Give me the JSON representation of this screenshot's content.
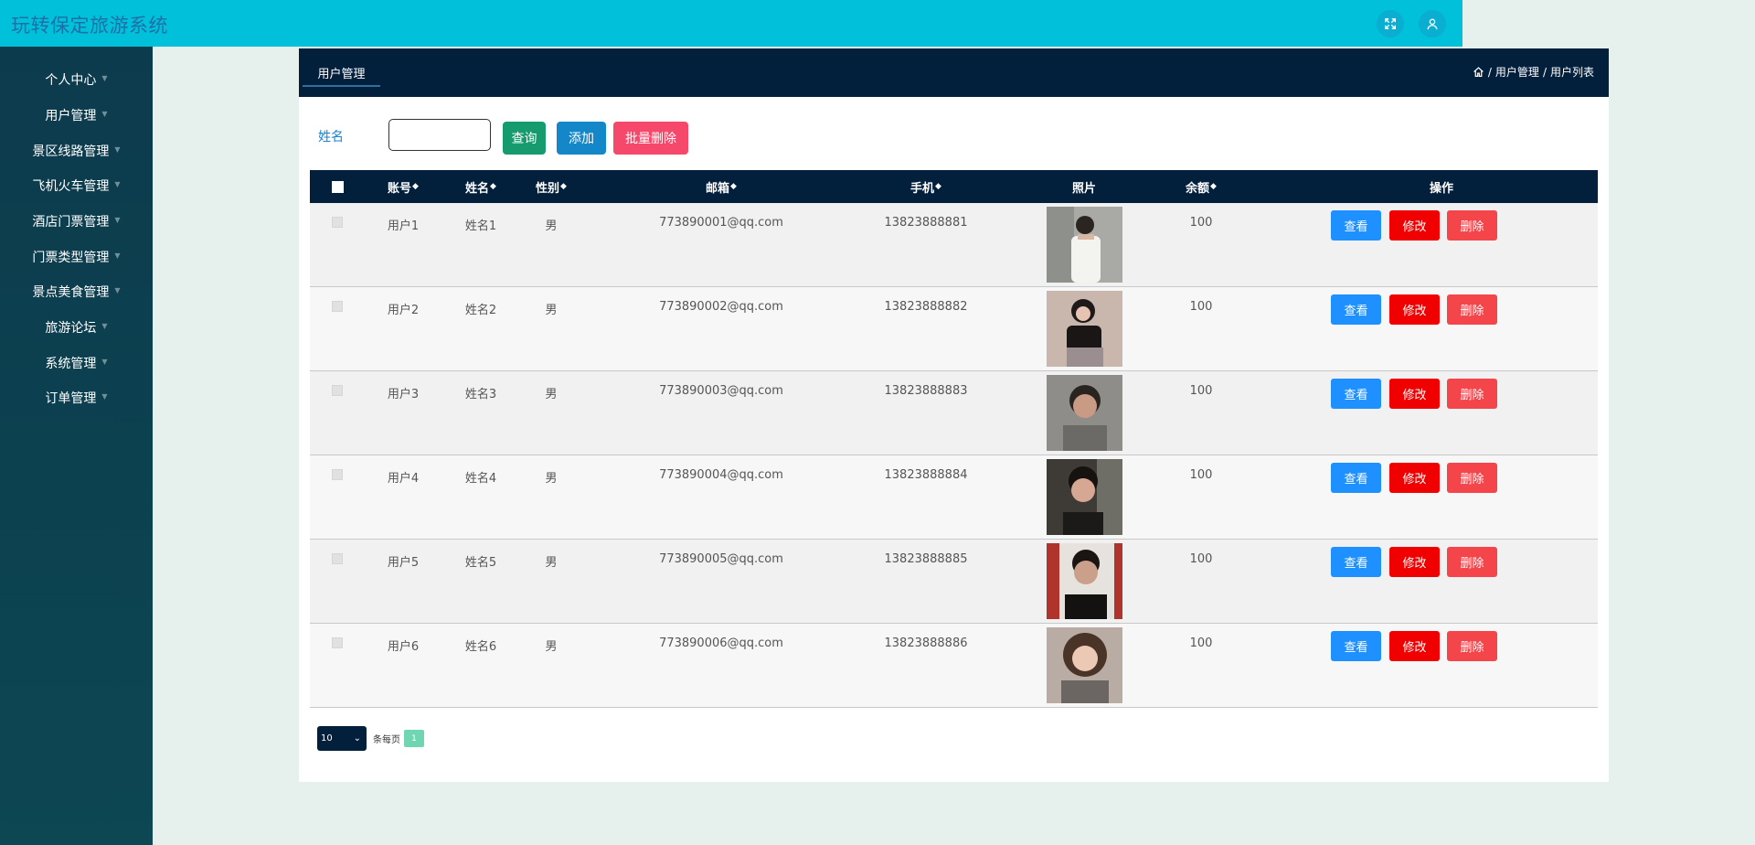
{
  "app": {
    "title": "玩转保定旅游系统"
  },
  "topbar": {
    "icons": [
      "fullscreen-icon",
      "user-icon"
    ]
  },
  "sidebar": {
    "items": [
      {
        "label": "个人中心"
      },
      {
        "label": "用户管理"
      },
      {
        "label": "景区线路管理"
      },
      {
        "label": "飞机火车管理"
      },
      {
        "label": "酒店门票管理"
      },
      {
        "label": "门票类型管理"
      },
      {
        "label": "景点美食管理"
      },
      {
        "label": "旅游论坛"
      },
      {
        "label": "系统管理"
      },
      {
        "label": "订单管理"
      }
    ]
  },
  "panel": {
    "tab": "用户管理",
    "breadcrumb": [
      "用户管理",
      "用户列表"
    ]
  },
  "search": {
    "label": "姓名",
    "value": "",
    "query_button": "查询",
    "add_button": "添加",
    "batch_delete_button": "批量删除"
  },
  "table": {
    "headers": {
      "account": "账号",
      "name": "姓名",
      "gender": "性别",
      "email": "邮箱",
      "phone": "手机",
      "photo": "照片",
      "balance": "余额",
      "actions": "操作"
    },
    "rows": [
      {
        "account": "用户1",
        "name": "姓名1",
        "gender": "男",
        "email": "773890001@qq.com",
        "phone": "13823888881",
        "balance": "100"
      },
      {
        "account": "用户2",
        "name": "姓名2",
        "gender": "男",
        "email": "773890002@qq.com",
        "phone": "13823888882",
        "balance": "100"
      },
      {
        "account": "用户3",
        "name": "姓名3",
        "gender": "男",
        "email": "773890003@qq.com",
        "phone": "13823888883",
        "balance": "100"
      },
      {
        "account": "用户4",
        "name": "姓名4",
        "gender": "男",
        "email": "773890004@qq.com",
        "phone": "13823888884",
        "balance": "100"
      },
      {
        "account": "用户5",
        "name": "姓名5",
        "gender": "男",
        "email": "773890005@qq.com",
        "phone": "13823888885",
        "balance": "100"
      },
      {
        "account": "用户6",
        "name": "姓名6",
        "gender": "男",
        "email": "773890006@qq.com",
        "phone": "13823888886",
        "balance": "100"
      }
    ],
    "row_buttons": {
      "view": "查看",
      "edit": "修改",
      "delete": "删除"
    }
  },
  "pagination": {
    "page_size": "10",
    "per_page_label": "条每页",
    "current_page": "1"
  },
  "colors": {
    "topbar": "#00c0da",
    "sidebar": "#0c3b4d",
    "header": "#021f3c",
    "query": "#159b6e",
    "add": "#1487c8",
    "batch_delete": "#f5486a",
    "view": "#1e90ff",
    "edit": "#f00000",
    "delete": "#f4454b"
  }
}
